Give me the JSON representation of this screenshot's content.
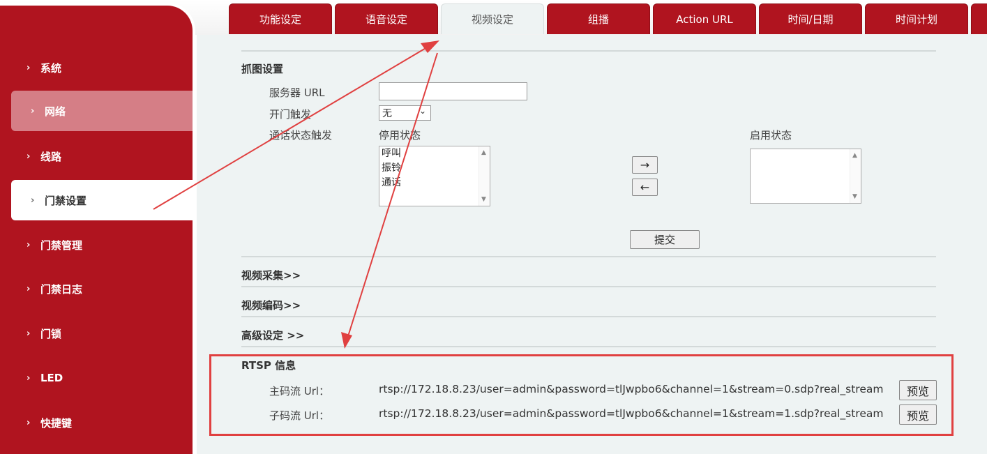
{
  "tabs": [
    {
      "label": "功能设定",
      "active": false
    },
    {
      "label": "语音设定",
      "active": false
    },
    {
      "label": "视频设定",
      "active": true
    },
    {
      "label": "组播",
      "active": false
    },
    {
      "label": "Action URL",
      "active": false
    },
    {
      "label": "时间/日期",
      "active": false
    },
    {
      "label": "时间计划",
      "active": false
    }
  ],
  "sidebar": {
    "items": [
      {
        "label": "系统",
        "state": "normal"
      },
      {
        "label": "网络",
        "state": "hover"
      },
      {
        "label": "线路",
        "state": "normal"
      },
      {
        "label": "门禁设置",
        "state": "selected"
      },
      {
        "label": "门禁管理",
        "state": "normal"
      },
      {
        "label": "门禁日志",
        "state": "normal"
      },
      {
        "label": "门锁",
        "state": "normal"
      },
      {
        "label": "LED",
        "state": "normal"
      },
      {
        "label": "快捷键",
        "state": "normal"
      }
    ]
  },
  "capture": {
    "title": "抓图设置",
    "server_url_label": "服务器 URL",
    "server_url_value": "",
    "door_trigger_label": "开门触发",
    "door_trigger_value": "无",
    "call_trigger_label": "通话状态触发",
    "disabled_label": "停用状态",
    "enabled_label": "启用状态",
    "disabled_options": [
      "呼叫",
      "振铃",
      "通话"
    ],
    "enabled_options": [],
    "move_right": "→",
    "move_left": "←",
    "submit": "提交"
  },
  "sections": {
    "video_capture": "视频采集>>",
    "video_encoding": "视频编码>>",
    "advanced": "高级设定 >>"
  },
  "rtsp": {
    "title": "RTSP 信息",
    "main_label": "主码流 Url：",
    "main_url": "rtsp://172.18.8.23/user=admin&password=tlJwpbo6&channel=1&stream=0.sdp?real_stream",
    "sub_label": "子码流 Url：",
    "sub_url": "rtsp://172.18.8.23/user=admin&password=tlJwpbo6&channel=1&stream=1.sdp?real_stream",
    "preview": "预览"
  },
  "colors": {
    "brand_red": "#b0141f",
    "annotation_red": "#e04040",
    "content_bg": "#eef3f3"
  }
}
